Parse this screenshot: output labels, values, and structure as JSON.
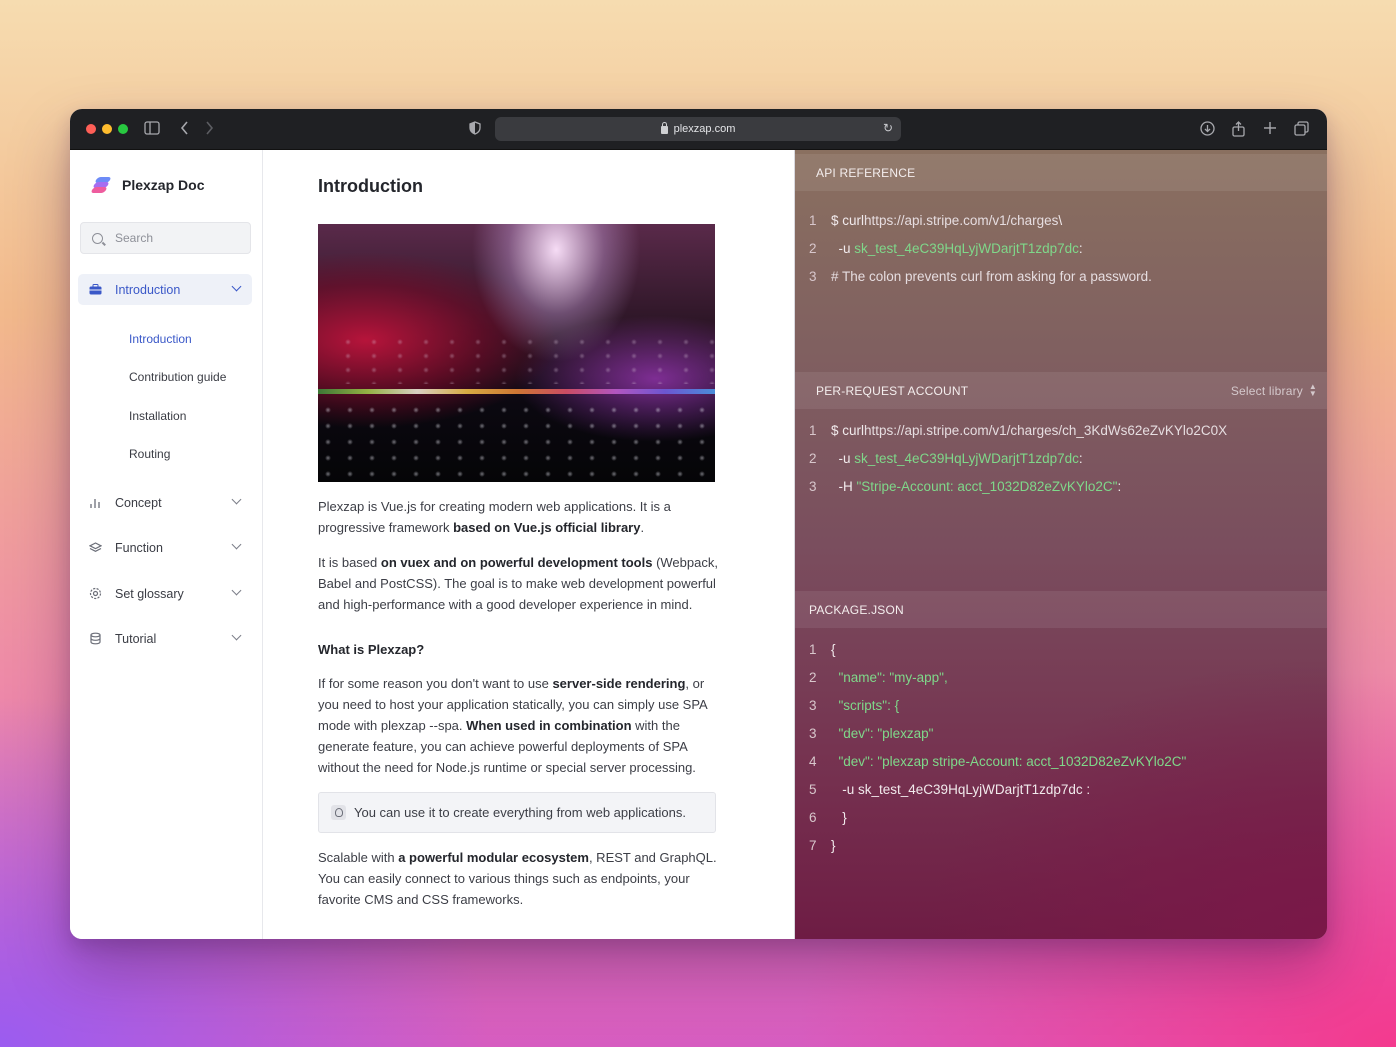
{
  "browser": {
    "url": "plexzap.com"
  },
  "sidebar": {
    "brand": "Plexzap Doc",
    "search_placeholder": "Search",
    "sections": [
      {
        "label": "Introduction",
        "icon": "briefcase-icon"
      },
      {
        "label": "Concept",
        "icon": "bar-chart-icon"
      },
      {
        "label": "Function",
        "icon": "layers-icon"
      },
      {
        "label": "Set glossary",
        "icon": "gear-icon"
      },
      {
        "label": "Tutorial",
        "icon": "stack-icon"
      }
    ],
    "subitems": [
      "Introduction",
      "Contribution guide",
      "Installation",
      "Routing"
    ]
  },
  "main": {
    "title": "Introduction",
    "p1_a": "Plexzap is Vue.js for creating modern web applications. It is a progressive framework ",
    "p1_b": "based on Vue.js official library",
    "p1_c": ".",
    "p2_a": "It is based ",
    "p2_b": "on vuex and on powerful development tools",
    "p2_c": " (Webpack, Babel and PostCSS). The goal is to make web development powerful and high-performance with a good developer experience in mind.",
    "subhead": "What is Plexzap?",
    "p3_a": "If for some reason you don't want to use ",
    "p3_b": "server-side rendering",
    "p3_c": ", or you need to host your application statically, you can simply use SPA mode with plexzap --spa. ",
    "p3_d": "When used in combination",
    "p3_e": " with the generate feature, you can achieve powerful deployments of SPA without the need for Node.js runtime or special server processing.",
    "tip": "You can use it to create everything from web applications.",
    "p4_a": "Scalable with ",
    "p4_b": "a powerful modular ecosystem",
    "p4_c": ", REST and GraphQL. You can easily connect to various things such as endpoints, your favorite CMS and CSS frameworks."
  },
  "code": {
    "api": {
      "title": "API REFERENCE",
      "lines": [
        {
          "n": "1",
          "a": "$ curl ",
          "b": "https://api.stripe.com/v1/charges",
          "c": " \\"
        },
        {
          "n": "2",
          "a": "  -u ",
          "g": "sk_test_4eC39HqLyjWDarjtT1zdp7dc",
          "c": " :"
        },
        {
          "n": "3",
          "a": "# The colon prevents curl from asking for a password."
        }
      ]
    },
    "per_request": {
      "title": "PER-REQUEST ACCOUNT",
      "select": "Select library",
      "lines": [
        {
          "n": "1",
          "a": "$ curl ",
          "b": "https://api.stripe.com/v1/charges/ch_3KdWs62eZvKYlo2C0X"
        },
        {
          "n": "2",
          "a": "  -u ",
          "g": "sk_test_4eC39HqLyjWDarjtT1zdp7dc",
          "c": " :"
        },
        {
          "n": "3",
          "a": "  -H ",
          "g": "\"Stripe-Account: acct_1032D82eZvKYlo2C\"",
          "c": " :"
        }
      ]
    },
    "package": {
      "title": "PACKAGE.JSON",
      "lines": [
        {
          "n": "1",
          "a": "{"
        },
        {
          "n": "2",
          "g": "  \"name\": \"my-app\","
        },
        {
          "n": "3",
          "g": "  \"scripts\": {"
        },
        {
          "n": "3",
          "g": "  \"dev\": \"plexzap\""
        },
        {
          "n": "4",
          "g": "  \"dev\": \"plexzap stripe-Account: acct_1032D82eZvKYlo2C\""
        },
        {
          "n": "5",
          "a": "   -u sk_test_4eC39HqLyjWDarjtT1zdp7dc :"
        },
        {
          "n": "6",
          "a": "   }"
        },
        {
          "n": "7",
          "a": "}"
        }
      ]
    }
  },
  "colors": {
    "accent": "#3a58c8",
    "code_green": "#7fd88a"
  }
}
